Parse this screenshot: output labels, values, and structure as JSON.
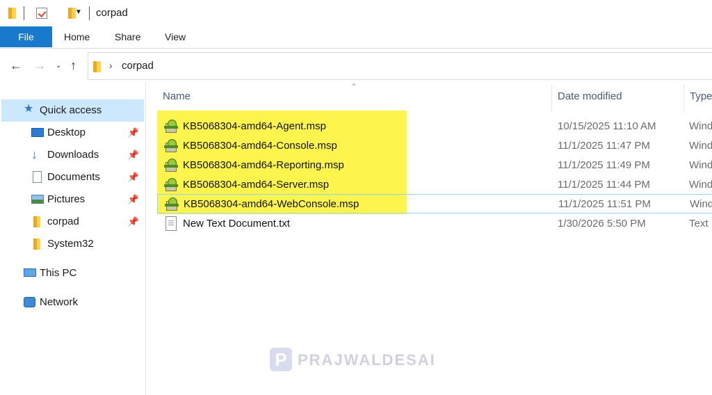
{
  "window": {
    "title": "corpad"
  },
  "quick_toolbar": {
    "folder_icon": "folder-icon",
    "properties_icon": "properties-check-icon",
    "new_folder_icon": "new-folder-icon",
    "dropdown_icon": "chevron-down-icon"
  },
  "ribbon": {
    "tabs": [
      {
        "label": "File",
        "active": true
      },
      {
        "label": "Home"
      },
      {
        "label": "Share"
      },
      {
        "label": "View"
      }
    ]
  },
  "navigation": {
    "back_icon": "arrow-left-icon",
    "forward_icon": "arrow-right-icon",
    "recent_icon": "chevron-down-icon",
    "up_icon": "arrow-up-icon",
    "address": {
      "segments": [
        "corpad"
      ]
    }
  },
  "sidebar": {
    "items": [
      {
        "label": "Quick access",
        "icon": "star-icon",
        "selected": true
      },
      {
        "label": "Desktop",
        "icon": "desktop-icon",
        "pinned": true
      },
      {
        "label": "Downloads",
        "icon": "download-icon",
        "pinned": true
      },
      {
        "label": "Documents",
        "icon": "document-icon",
        "pinned": true
      },
      {
        "label": "Pictures",
        "icon": "pictures-icon",
        "pinned": true
      },
      {
        "label": "corpad",
        "icon": "folder-icon",
        "pinned": true
      },
      {
        "label": "System32",
        "icon": "folder-icon"
      },
      {
        "label": "This PC",
        "icon": "computer-icon"
      },
      {
        "label": "Network",
        "icon": "network-icon"
      }
    ],
    "pin_icon": "pin-icon"
  },
  "file_list": {
    "columns": [
      "Name",
      "Date modified",
      "Type"
    ],
    "sort_column": "Name",
    "files": [
      {
        "name": "KB5068304-amd64-Agent.msp",
        "date": "10/15/2025 11:10 AM",
        "type": "Wind",
        "icon": "msp-installer-icon",
        "highlighted": true
      },
      {
        "name": "KB5068304-amd64-Console.msp",
        "date": "11/1/2025 11:47 PM",
        "type": "Wind",
        "icon": "msp-installer-icon",
        "highlighted": true
      },
      {
        "name": "KB5068304-amd64-Reporting.msp",
        "date": "11/1/2025 11:49 PM",
        "type": "Wind",
        "icon": "msp-installer-icon",
        "highlighted": true
      },
      {
        "name": "KB5068304-amd64-Server.msp",
        "date": "11/1/2025 11:44 PM",
        "type": "Wind",
        "icon": "msp-installer-icon",
        "highlighted": true
      },
      {
        "name": "KB5068304-amd64-WebConsole.msp",
        "date": "11/1/2025 11:51 PM",
        "type": "Wind",
        "icon": "msp-installer-icon",
        "highlighted": true,
        "focused": true
      },
      {
        "name": "New Text Document.txt",
        "date": "1/30/2026 5:50 PM",
        "type": "Text",
        "icon": "text-file-icon"
      }
    ]
  },
  "watermark": {
    "text": "PRAJWALDESAI",
    "logo_letter": "P"
  },
  "colors": {
    "accent": "#1979ca",
    "selection": "#cce8ff",
    "highlight": "#fdf54d"
  }
}
